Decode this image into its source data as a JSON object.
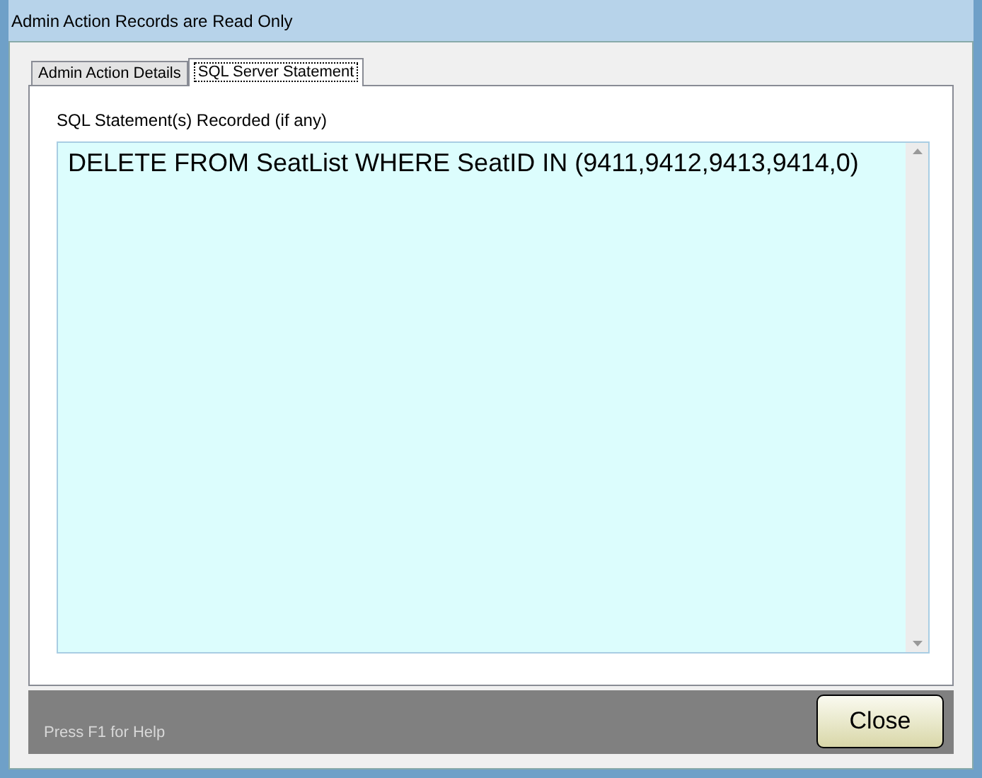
{
  "window": {
    "title": "Admin Action Records are Read Only"
  },
  "tabs": [
    {
      "label": "Admin Action Details",
      "selected": false
    },
    {
      "label": "SQL Server Statement",
      "selected": true
    }
  ],
  "sql_field": {
    "label": "SQL Statement(s) Recorded (if any)",
    "value": "DELETE FROM SeatList WHERE SeatID IN (9411,9412,9413,9414,0)"
  },
  "status_bar": {
    "help_text": "Press F1 for Help"
  },
  "buttons": [
    {
      "label": "Close"
    }
  ]
}
